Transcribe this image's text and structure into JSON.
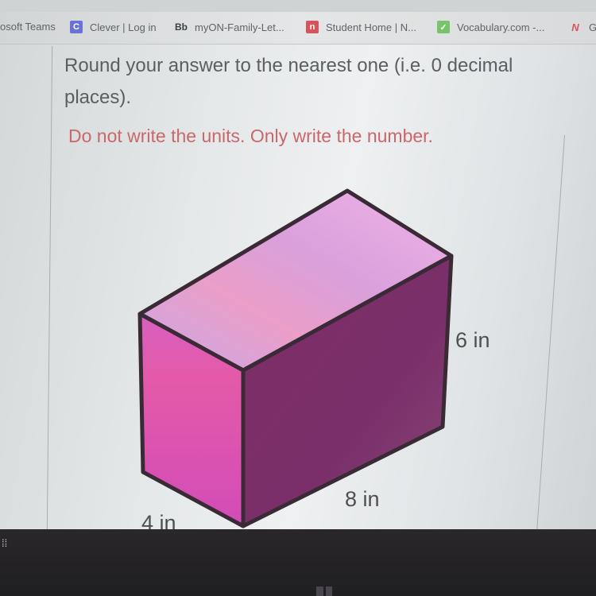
{
  "bookmarks": [
    {
      "label": "osoft Teams",
      "icon": "teams-icon",
      "icon_text": "",
      "icon_color": ""
    },
    {
      "label": "Clever | Log in",
      "icon": "clever-icon",
      "icon_text": "C",
      "icon_color": "#6a73d4"
    },
    {
      "label": "myON-Family-Let...",
      "icon": "blackboard-icon",
      "icon_text": "Bb",
      "icon_color": ""
    },
    {
      "label": "Student Home | N...",
      "icon": "newsela-icon",
      "icon_text": "n",
      "icon_color": "#d9535a"
    },
    {
      "label": "Vocabulary.com -...",
      "icon": "vocabulary-check-icon",
      "icon_text": "✓",
      "icon_color": "#79c46a"
    },
    {
      "label": "G",
      "icon": "n-logo-icon",
      "icon_text": "N",
      "icon_color": "#d9535a"
    }
  ],
  "question": {
    "instruction": "Round your answer to the nearest one (i.e. 0 decimal places).",
    "warning": "Do not write the units. Only write the number.",
    "warning_color": "#c9676b"
  },
  "figure": {
    "shape": "rectangular prism",
    "height_label": "6 in",
    "length_label": "8 in",
    "width_label": "4 in",
    "colors": {
      "top": "#e6a6de",
      "front": "#d048b4",
      "side": "#7a2d68",
      "edge": "#3a2a36"
    }
  },
  "taskbar": {
    "left_icon": "taskbar-icon"
  }
}
